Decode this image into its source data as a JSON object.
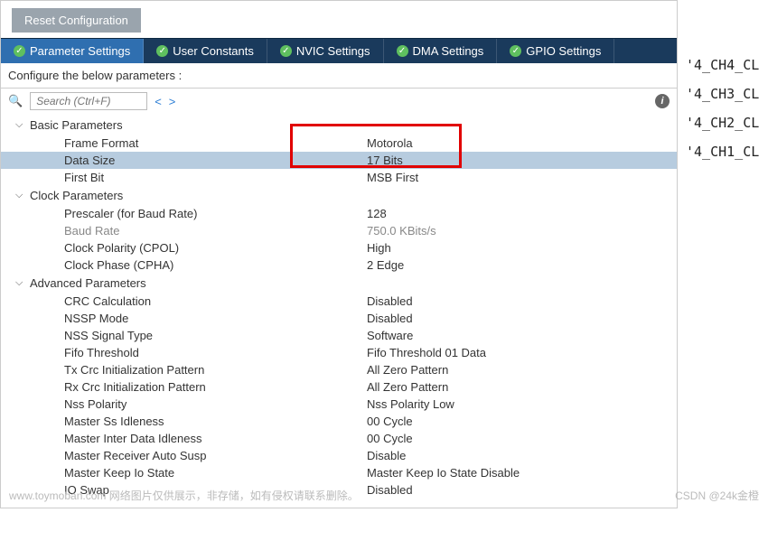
{
  "reset_button": "Reset Configuration",
  "tabs": [
    {
      "label": "Parameter Settings",
      "active": true
    },
    {
      "label": "User Constants",
      "active": false
    },
    {
      "label": "NVIC Settings",
      "active": false
    },
    {
      "label": "DMA Settings",
      "active": false
    },
    {
      "label": "GPIO Settings",
      "active": false
    }
  ],
  "config_line": "Configure the below parameters :",
  "search_placeholder": "Search (Ctrl+F)",
  "groups": [
    {
      "name": "Basic Parameters",
      "rows": [
        {
          "label": "Frame Format",
          "value": "Motorola",
          "selected": false,
          "grey": false
        },
        {
          "label": "Data Size",
          "value": "17 Bits",
          "selected": true,
          "grey": false
        },
        {
          "label": "First Bit",
          "value": "MSB First",
          "selected": false,
          "grey": false
        }
      ]
    },
    {
      "name": "Clock Parameters",
      "rows": [
        {
          "label": "Prescaler (for Baud Rate)",
          "value": "128",
          "selected": false,
          "grey": false
        },
        {
          "label": "Baud Rate",
          "value": "750.0 KBits/s",
          "selected": false,
          "grey": true
        },
        {
          "label": "Clock Polarity (CPOL)",
          "value": "High",
          "selected": false,
          "grey": false
        },
        {
          "label": "Clock Phase (CPHA)",
          "value": "2 Edge",
          "selected": false,
          "grey": false
        }
      ]
    },
    {
      "name": "Advanced Parameters",
      "rows": [
        {
          "label": "CRC Calculation",
          "value": "Disabled",
          "selected": false,
          "grey": false
        },
        {
          "label": "NSSP Mode",
          "value": "Disabled",
          "selected": false,
          "grey": false
        },
        {
          "label": "NSS Signal Type",
          "value": "Software",
          "selected": false,
          "grey": false
        },
        {
          "label": "Fifo Threshold",
          "value": "Fifo Threshold 01 Data",
          "selected": false,
          "grey": false
        },
        {
          "label": "Tx Crc Initialization Pattern",
          "value": "All Zero Pattern",
          "selected": false,
          "grey": false
        },
        {
          "label": "Rx Crc Initialization Pattern",
          "value": "All Zero Pattern",
          "selected": false,
          "grey": false
        },
        {
          "label": "Nss Polarity",
          "value": "Nss Polarity Low",
          "selected": false,
          "grey": false
        },
        {
          "label": "Master Ss Idleness",
          "value": "00 Cycle",
          "selected": false,
          "grey": false
        },
        {
          "label": "Master Inter Data Idleness",
          "value": "00 Cycle",
          "selected": false,
          "grey": false
        },
        {
          "label": "Master Receiver Auto Susp",
          "value": "Disable",
          "selected": false,
          "grey": false
        },
        {
          "label": "Master Keep Io State",
          "value": "Master Keep Io State Disable",
          "selected": false,
          "grey": false
        },
        {
          "label": "IO Swap",
          "value": "Disabled",
          "selected": false,
          "grey": false
        }
      ]
    }
  ],
  "right_labels": [
    "'4_CH4_CL",
    "'4_CH3_CL",
    "'4_CH2_CL",
    "'4_CH1_CL"
  ],
  "watermark1": "www.toymoban.com  网络图片仅供展示，非存储，如有侵权请联系删除。",
  "watermark2": "CSDN @24k金橙"
}
